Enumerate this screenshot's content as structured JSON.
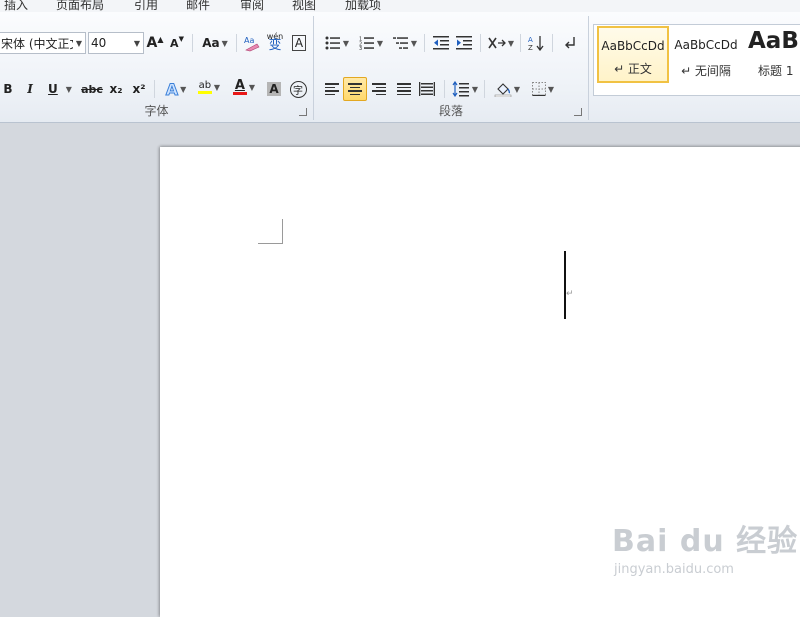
{
  "menu": {
    "tabs": [
      "插入",
      "页面布局",
      "引用",
      "邮件",
      "审阅",
      "视图",
      "加载项"
    ]
  },
  "font_group": {
    "label": "字体",
    "font_name": "宋体 (中文正文)",
    "font_size": "40",
    "grow_glyph": "A",
    "shrink_glyph": "A",
    "case_label": "Aa",
    "phonetic_glyph": "wén",
    "phonetic_char": "变",
    "border_glyph": "A",
    "bold": "B",
    "italic": "I",
    "underline": "U",
    "strike": "abc",
    "subscript": "x₂",
    "superscript": "x²",
    "effects_glyph": "A",
    "highlight_glyph": "ab",
    "font_color_glyph": "A",
    "shading_glyph": "A",
    "enclose_glyph": "字",
    "colors": {
      "highlight": "#ffff00",
      "font_color": "#e81818"
    }
  },
  "paragraph_group": {
    "label": "段落"
  },
  "styles_group": {
    "items": [
      {
        "sample": "AaBbCcDd",
        "name": "↵ 正文",
        "selected": true
      },
      {
        "sample": "AaBbCcDd",
        "name": "↵ 无间隔",
        "selected": false
      },
      {
        "sample": "AaBl",
        "name": "标题 1",
        "selected": false
      }
    ]
  },
  "document": {
    "paragraph_mark": "↵"
  },
  "watermark": {
    "brand": "Bai du 经验",
    "url": "jingyan.baidu.com"
  }
}
